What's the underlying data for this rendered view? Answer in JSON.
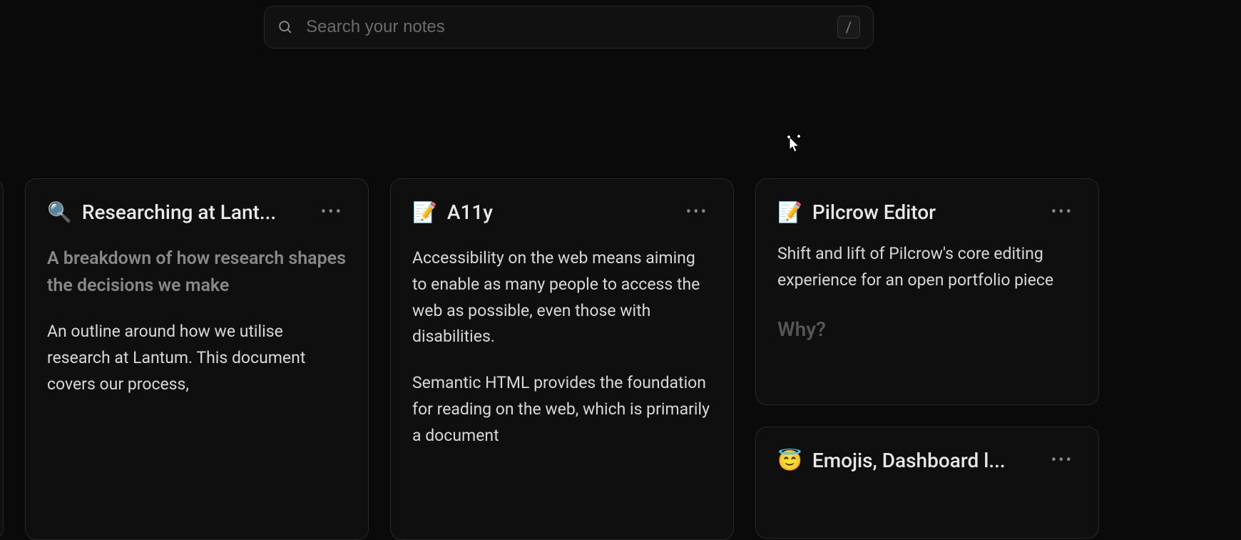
{
  "search": {
    "placeholder": "Search your notes",
    "shortcut": "/"
  },
  "cards": [
    {
      "emoji": "🔍",
      "title": "Researching at Lant...",
      "subtitle": "A breakdown of how research shapes the decisions we make",
      "body1": "An outline around how we utilise research at Lantum. This document covers our process,"
    },
    {
      "emoji": "📝",
      "title": "A11y",
      "body1": "Accessibility on the web means aiming to enable as many people to access the web as possible, even those with disabilities.",
      "body2": "Semantic HTML provides the foundation for reading on the web, which is primarily a document"
    },
    {
      "emoji": "📝",
      "title": "Pilcrow Editor",
      "body1": "Shift and lift of Pilcrow's core editing experience for an open portfolio piece",
      "heading": "Why?"
    },
    {
      "emoji": "😇",
      "title": "Emojis, Dashboard l..."
    }
  ]
}
